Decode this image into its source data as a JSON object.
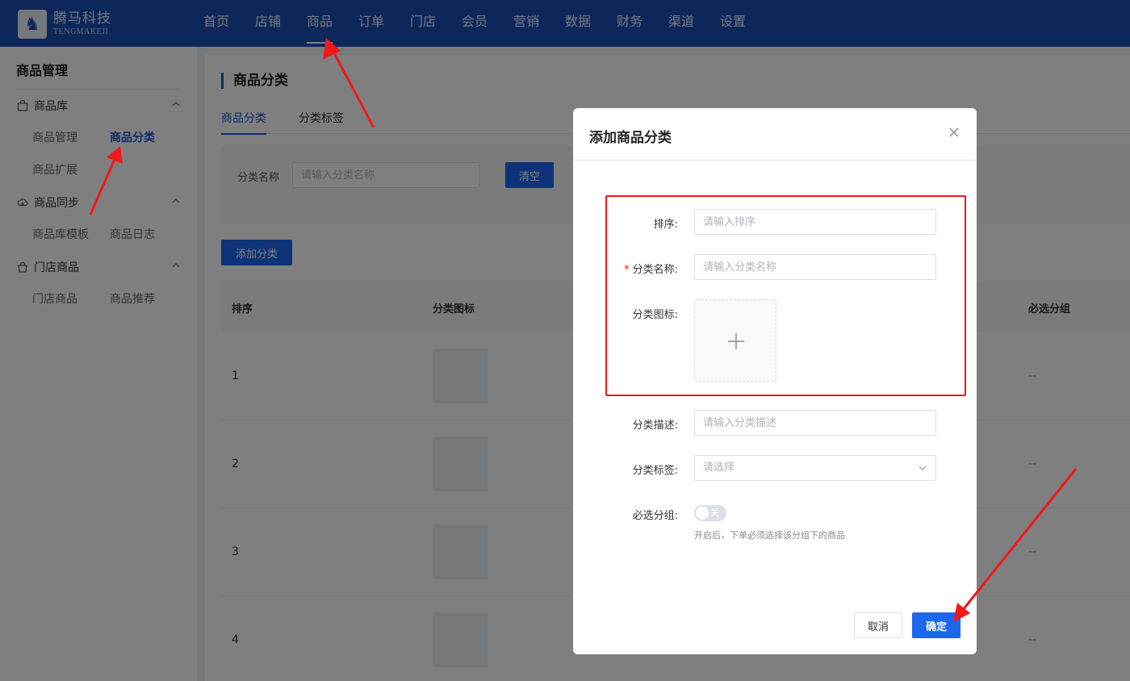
{
  "brand": {
    "name_cn": "腾马科技",
    "name_en": "TENGMAKEJI",
    "logo_icon": "horse-logo-icon"
  },
  "topnav": [
    {
      "label": "首页",
      "active": false
    },
    {
      "label": "店铺",
      "active": false
    },
    {
      "label": "商品",
      "active": true
    },
    {
      "label": "订单",
      "active": false
    },
    {
      "label": "门店",
      "active": false
    },
    {
      "label": "会员",
      "active": false
    },
    {
      "label": "营销",
      "active": false
    },
    {
      "label": "数据",
      "active": false
    },
    {
      "label": "财务",
      "active": false
    },
    {
      "label": "渠道",
      "active": false
    },
    {
      "label": "设置",
      "active": false
    }
  ],
  "sidebar": {
    "title": "商品管理",
    "groups": [
      {
        "label": "商品库",
        "icon": "bag-icon",
        "items": [
          {
            "label": "商品管理"
          },
          {
            "label": "商品分类",
            "active": true
          },
          {
            "label": "商品扩展"
          }
        ]
      },
      {
        "label": "商品同步",
        "icon": "cloud-sync-icon",
        "items": [
          {
            "label": "商品库模板"
          },
          {
            "label": "商品日志"
          }
        ]
      },
      {
        "label": "门店商品",
        "icon": "store-bag-icon",
        "items": [
          {
            "label": "门店商品"
          },
          {
            "label": "商品推荐"
          }
        ]
      }
    ]
  },
  "main": {
    "title": "商品分类",
    "tabs": [
      {
        "label": "商品分类",
        "active": true
      },
      {
        "label": "分类标签",
        "active": false
      }
    ],
    "filter": {
      "label": "分类名称",
      "placeholder": "请输入分类名称",
      "clear_label": "清空"
    },
    "add_label": "添加分类",
    "table": {
      "headers": {
        "sort": "排序",
        "icon": "分类图标",
        "required": "必选分组"
      },
      "rows": [
        {
          "sort": "1",
          "required": "--"
        },
        {
          "sort": "2",
          "required": "--"
        },
        {
          "sort": "3",
          "required": "--"
        },
        {
          "sort": "4",
          "required": "--"
        }
      ]
    }
  },
  "dialog": {
    "title": "添加商品分类",
    "fields": {
      "sort": {
        "label": "排序:",
        "placeholder": "请输入排序"
      },
      "name": {
        "label": "分类名称:",
        "placeholder": "请输入分类名称",
        "required_mark": "*"
      },
      "icon": {
        "label": "分类图标:"
      },
      "desc": {
        "label": "分类描述:",
        "placeholder": "请输入分类描述"
      },
      "tag": {
        "label": "分类标签:",
        "placeholder": "请选择"
      },
      "required_group": {
        "label": "必选分组:",
        "toggle_text": "关",
        "toggle_on": false,
        "hint": "开启后，下单必须选择该分组下的商品"
      }
    },
    "cancel_label": "取消",
    "confirm_label": "确定"
  },
  "colors": {
    "header_bg": "#1d4fb4",
    "primary": "#1d66f0",
    "highlight": "#f0191a",
    "annotation_arrow": "#f0191a"
  }
}
